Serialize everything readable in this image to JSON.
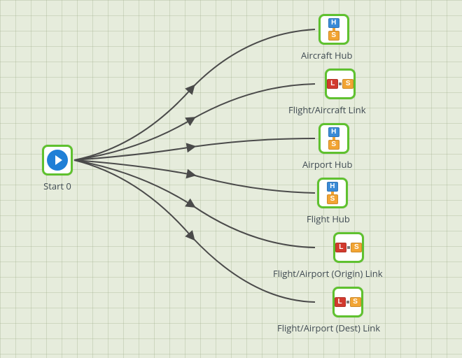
{
  "nodes": {
    "start": {
      "label": "Start 0",
      "type": "start"
    },
    "aircraft_hub": {
      "label": "Aircraft Hub",
      "type": "hub"
    },
    "flight_aircraft_link": {
      "label": "Flight/Aircraft Link",
      "type": "link"
    },
    "airport_hub": {
      "label": "Airport Hub",
      "type": "hub"
    },
    "flight_hub": {
      "label": "Flight Hub",
      "type": "hub"
    },
    "flight_airport_origin_link": {
      "label": "Flight/Airport (Origin) Link",
      "type": "link"
    },
    "flight_airport_dest_link": {
      "label": "Flight/Airport (Dest) Link",
      "type": "link"
    }
  },
  "edges": [
    {
      "from": "start",
      "to": "aircraft_hub"
    },
    {
      "from": "start",
      "to": "flight_aircraft_link"
    },
    {
      "from": "start",
      "to": "airport_hub"
    },
    {
      "from": "start",
      "to": "flight_hub"
    },
    {
      "from": "start",
      "to": "flight_airport_origin_link"
    },
    {
      "from": "start",
      "to": "flight_airport_dest_link"
    }
  ],
  "colors": {
    "node_border": "#5fc12f",
    "edge": "#4a4a4a",
    "canvas_bg": "#e6ecdc"
  }
}
